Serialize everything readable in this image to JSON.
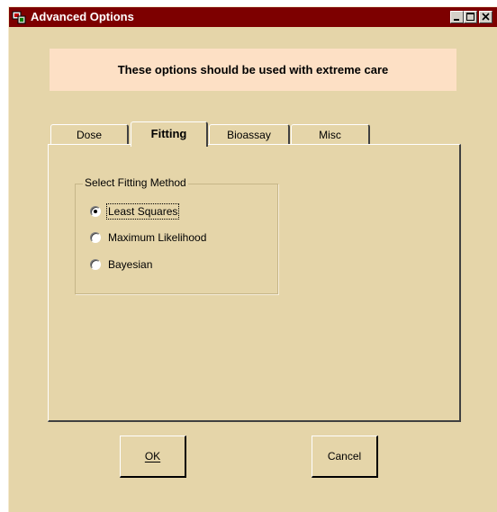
{
  "window": {
    "title": "Advanced Options",
    "title_bar_color": "#7d0000",
    "body_color": "#e5d5a9",
    "controls": [
      "minimize-icon",
      "maximize-icon",
      "close-icon"
    ]
  },
  "warning": {
    "text": "These options should be used with extreme care",
    "background": "#fde0c5"
  },
  "tabs": [
    {
      "label": "Dose",
      "active": false
    },
    {
      "label": "Fitting",
      "active": true
    },
    {
      "label": "Bioassay",
      "active": false
    },
    {
      "label": "Misc",
      "active": false
    }
  ],
  "fitting": {
    "group_label": "Select Fitting Method",
    "options": [
      {
        "label": "Least Squares",
        "selected": true
      },
      {
        "label": "Maximum Likelihood",
        "selected": false
      },
      {
        "label": "Bayesian",
        "selected": false
      }
    ]
  },
  "buttons": {
    "ok_label": "OK",
    "cancel_label": "Cancel"
  }
}
